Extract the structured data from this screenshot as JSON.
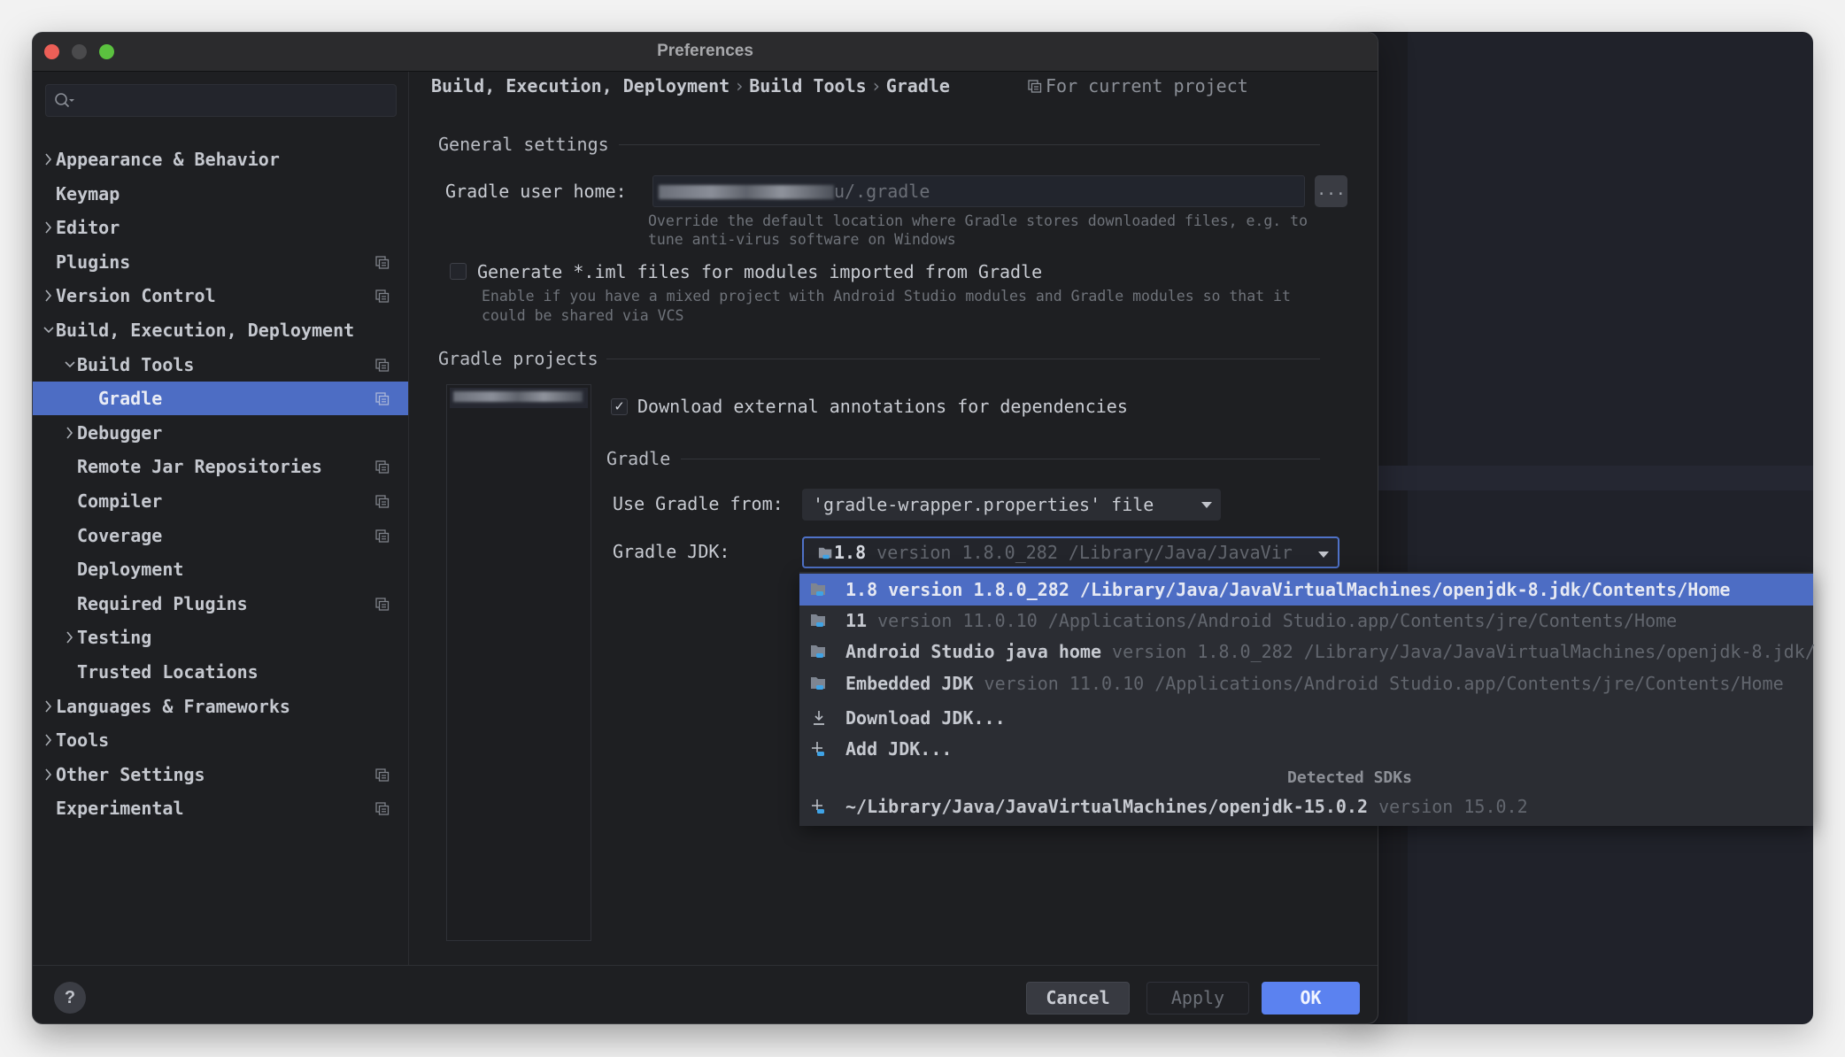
{
  "window": {
    "title": "Preferences"
  },
  "sidebar": {
    "search": {
      "placeholder": "",
      "value": ""
    },
    "items": [
      {
        "label": "Appearance & Behavior",
        "level": 0,
        "expander": "collapsed",
        "project_icon": false,
        "selected": false
      },
      {
        "label": "Keymap",
        "level": 0,
        "expander": "none",
        "project_icon": false,
        "selected": false
      },
      {
        "label": "Editor",
        "level": 0,
        "expander": "collapsed",
        "project_icon": false,
        "selected": false
      },
      {
        "label": "Plugins",
        "level": 0,
        "expander": "none",
        "project_icon": true,
        "selected": false
      },
      {
        "label": "Version Control",
        "level": 0,
        "expander": "collapsed",
        "project_icon": true,
        "selected": false
      },
      {
        "label": "Build, Execution, Deployment",
        "level": 0,
        "expander": "expanded",
        "project_icon": false,
        "selected": false
      },
      {
        "label": "Build Tools",
        "level": 1,
        "expander": "expanded",
        "project_icon": true,
        "selected": false
      },
      {
        "label": "Gradle",
        "level": 2,
        "expander": "none",
        "project_icon": true,
        "selected": true
      },
      {
        "label": "Debugger",
        "level": 1,
        "expander": "collapsed",
        "project_icon": false,
        "selected": false
      },
      {
        "label": "Remote Jar Repositories",
        "level": 1,
        "expander": "none",
        "project_icon": true,
        "selected": false
      },
      {
        "label": "Compiler",
        "level": 1,
        "expander": "none",
        "project_icon": true,
        "selected": false
      },
      {
        "label": "Coverage",
        "level": 1,
        "expander": "none",
        "project_icon": true,
        "selected": false
      },
      {
        "label": "Deployment",
        "level": 1,
        "expander": "none",
        "project_icon": false,
        "selected": false
      },
      {
        "label": "Required Plugins",
        "level": 1,
        "expander": "none",
        "project_icon": true,
        "selected": false
      },
      {
        "label": "Testing",
        "level": 1,
        "expander": "collapsed",
        "project_icon": false,
        "selected": false
      },
      {
        "label": "Trusted Locations",
        "level": 1,
        "expander": "none",
        "project_icon": false,
        "selected": false
      },
      {
        "label": "Languages & Frameworks",
        "level": 0,
        "expander": "collapsed",
        "project_icon": false,
        "selected": false
      },
      {
        "label": "Tools",
        "level": 0,
        "expander": "collapsed",
        "project_icon": false,
        "selected": false
      },
      {
        "label": "Other Settings",
        "level": 0,
        "expander": "collapsed",
        "project_icon": true,
        "selected": false
      },
      {
        "label": "Experimental",
        "level": 0,
        "expander": "none",
        "project_icon": true,
        "selected": false
      }
    ]
  },
  "breadcrumb": {
    "items": [
      "Build, Execution, Deployment",
      "Build Tools",
      "Gradle"
    ],
    "separator": "›",
    "scope_label": "For current project"
  },
  "general_settings": {
    "header": "General settings",
    "gradle_user_home": {
      "label": "Gradle user home:",
      "value_visible_suffix": "u/.gradle",
      "value_redacted": true,
      "browse_label": "..."
    },
    "gradle_user_home_help": [
      "Override the default location where Gradle stores downloaded files, e.g. to",
      "tune anti-virus software on Windows"
    ],
    "generate_iml": {
      "label": "Generate *.iml files for modules imported from Gradle",
      "checked": false,
      "help": [
        "Enable if you have a mixed project with Android Studio modules and Gradle modules so that it",
        "could be shared via VCS"
      ]
    }
  },
  "gradle_projects": {
    "header": "Gradle projects",
    "project_name_redacted": true,
    "download_annotations": {
      "label": "Download external annotations for dependencies",
      "checked": true,
      "check_glyph": "✓"
    },
    "gradle_section": {
      "header": "Gradle",
      "use_gradle_from": {
        "label": "Use Gradle from:",
        "value": "'gradle-wrapper.properties' file"
      },
      "gradle_jdk": {
        "label": "Gradle JDK:",
        "value_main": "1.8",
        "value_secondary": "version 1.8.0_282 /Library/Java/JavaVir"
      }
    }
  },
  "jdk_popup": {
    "items": [
      {
        "icon": "folder-java-icon",
        "main": "1.8",
        "secondary": "version 1.8.0_282 /Library/Java/JavaVirtualMachines/openjdk-8.jdk/Contents/Home",
        "selected": true
      },
      {
        "icon": "folder-java-icon",
        "main": "11",
        "secondary": "version 11.0.10 /Applications/Android Studio.app/Contents/jre/Contents/Home",
        "selected": false
      },
      {
        "icon": "folder-java-icon",
        "main": "Android Studio java home",
        "secondary": "version 1.8.0_282 /Library/Java/JavaVirtualMachines/openjdk-8.jdk/",
        "selected": false
      },
      {
        "icon": "folder-java-icon",
        "main": "Embedded JDK",
        "secondary": "version 11.0.10 /Applications/Android Studio.app/Contents/jre/Contents/Home",
        "selected": false
      },
      {
        "icon": "download-icon",
        "main": "Download JDK...",
        "secondary": "",
        "selected": false
      },
      {
        "icon": "add-jdk-icon",
        "main": "Add JDK...",
        "secondary": "",
        "selected": false
      }
    ],
    "detected_header": "Detected SDKs",
    "detected": [
      {
        "icon": "add-jdk-icon",
        "main": "~/Library/Java/JavaVirtualMachines/openjdk-15.0.2",
        "secondary": "version 15.0.2"
      }
    ]
  },
  "footer": {
    "help_label": "?",
    "cancel_label": "Cancel",
    "apply_label": "Apply",
    "ok_label": "OK"
  },
  "colors": {
    "accent": "#4d6dc4",
    "ok_button": "#5b82f0",
    "dialog_bg": "#1e1f22",
    "traffic_close": "#ec5f57",
    "traffic_max": "#5bc13f"
  }
}
